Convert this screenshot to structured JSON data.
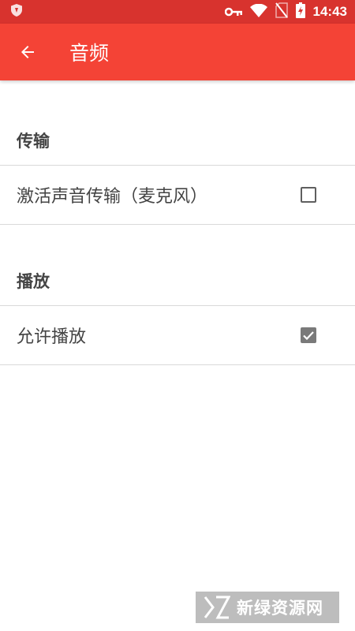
{
  "status_bar": {
    "time": "14:43",
    "icons": [
      "shield-icon",
      "vpn-key-icon",
      "wifi-icon",
      "no-sim-icon",
      "battery-charging-icon"
    ]
  },
  "app_bar": {
    "back_icon": "arrow-left-icon",
    "title": "音频",
    "color": "#f44336",
    "status_color": "#d8332e"
  },
  "sections": [
    {
      "header": "传输",
      "items": [
        {
          "label": "激活声音传输（麦克风）",
          "checked": false
        }
      ]
    },
    {
      "header": "播放",
      "items": [
        {
          "label": "允许播放",
          "checked": true
        }
      ]
    }
  ],
  "watermark": {
    "text": "新绿资源网"
  }
}
